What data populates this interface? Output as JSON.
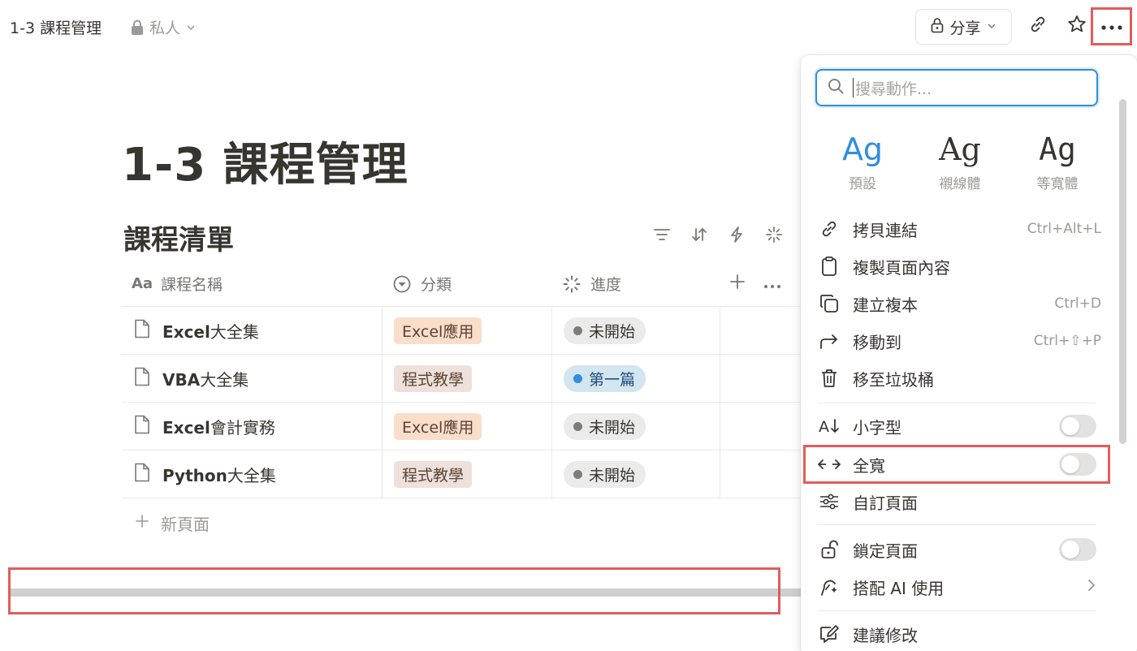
{
  "topbar": {
    "title": "1-3 課程管理",
    "privacy": "私人",
    "share_label": "分享"
  },
  "page": {
    "title": "1-3 課程管理",
    "db_title": "課程清單"
  },
  "table": {
    "headers": {
      "name": "課程名稱",
      "category": "分類",
      "progress": "進度",
      "name_prefix": "Aa"
    },
    "rows": [
      {
        "name_bold": "Excel",
        "name_rest": "大全集",
        "category": "Excel應用",
        "status": "未開始"
      },
      {
        "name_bold": "VBA",
        "name_rest": "大全集",
        "category": "程式教學",
        "status": "第一篇"
      },
      {
        "name_bold": "Excel",
        "name_rest": "會計實務",
        "category": "Excel應用",
        "status": "未開始"
      },
      {
        "name_bold": "Python",
        "name_rest": "大全集",
        "category": "程式教學",
        "status": "未開始"
      }
    ],
    "new_page": "新頁面",
    "tag_colors": {
      "Excel應用": "#fadec9",
      "程式教學": "#eee0da"
    },
    "status_colors": {
      "未開始": "#ebebea",
      "第一篇": "#d3e5ef"
    },
    "status_dot_colors": {
      "未開始": "#7d7c78",
      "第一篇": "#2f8ede"
    }
  },
  "menu": {
    "search_placeholder": "搜尋動作...",
    "fonts": [
      {
        "sample": "Ag",
        "label": "預設"
      },
      {
        "sample": "Ag",
        "label": "襯線體"
      },
      {
        "sample": "Ag",
        "label": "等寬體"
      }
    ],
    "items": {
      "copy_link": {
        "label": "拷貝連結",
        "shortcut": "Ctrl+Alt+L"
      },
      "copy_content": {
        "label": "複製頁面內容"
      },
      "duplicate": {
        "label": "建立複本",
        "shortcut": "Ctrl+D"
      },
      "move_to": {
        "label": "移動到",
        "shortcut": "Ctrl+⇧+P"
      },
      "trash": {
        "label": "移至垃圾桶"
      },
      "small_text": {
        "label": "小字型"
      },
      "full_width": {
        "label": "全寬"
      },
      "customize": {
        "label": "自訂頁面"
      },
      "lock": {
        "label": "鎖定頁面"
      },
      "ai": {
        "label": "搭配 AI 使用"
      },
      "suggest": {
        "label": "建議修改"
      }
    }
  },
  "colors": {
    "accent": "#2f8ede",
    "highlight": "#e25c5c"
  }
}
